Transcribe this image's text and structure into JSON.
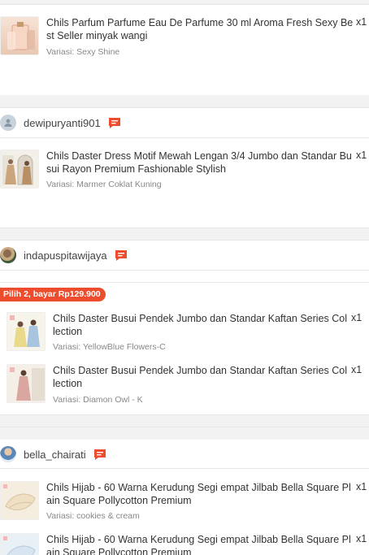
{
  "orders": [
    {
      "items": [
        {
          "title": "Chils Parfum Parfume Eau De Parfume 30 ml Aroma Fresh Sexy Best Seller minyak wangi",
          "qty": "x1",
          "variant": "Variasi: Sexy Shine"
        }
      ]
    },
    {
      "shop": "dewipuryanti901",
      "items": [
        {
          "title": "Chils Daster Dress Motif Mewah Lengan 3/4 Jumbo dan Standar Busui Rayon Premium Fashionable Stylish",
          "qty": "x1",
          "variant": "Variasi: Marmer Coklat Kuning"
        }
      ]
    },
    {
      "shop": "indapuspitawijaya",
      "promo": "Pilih 2, bayar Rp129.900",
      "items": [
        {
          "title": "Chils Daster Busui Pendek Jumbo dan Standar Kaftan Series Collection",
          "qty": "x1",
          "variant": "Variasi: YellowBlue Flowers-C"
        },
        {
          "title": "Chils Daster Busui Pendek Jumbo dan Standar Kaftan Series Collection",
          "qty": "x1",
          "variant": "Variasi: Diamon Owl - K"
        }
      ]
    },
    {
      "shop": "bella_chairati",
      "items": [
        {
          "title": "Chils Hijab - 60 Warna Kerudung Segi empat Jilbab Bella Square Plain Square Pollycotton Premium",
          "qty": "x1",
          "variant": "Variasi: cookies & cream"
        },
        {
          "title": "Chils Hijab - 60 Warna Kerudung Segi empat Jilbab Bella Square Plain Square Pollycotton Premium",
          "qty": "x1",
          "variant": ""
        }
      ]
    }
  ],
  "icons": {
    "chat": "chat-bubble-icon",
    "avatar_placeholder": "user-icon"
  },
  "colors": {
    "accent": "#ee4d2d",
    "chat": "#ee4d2d"
  }
}
